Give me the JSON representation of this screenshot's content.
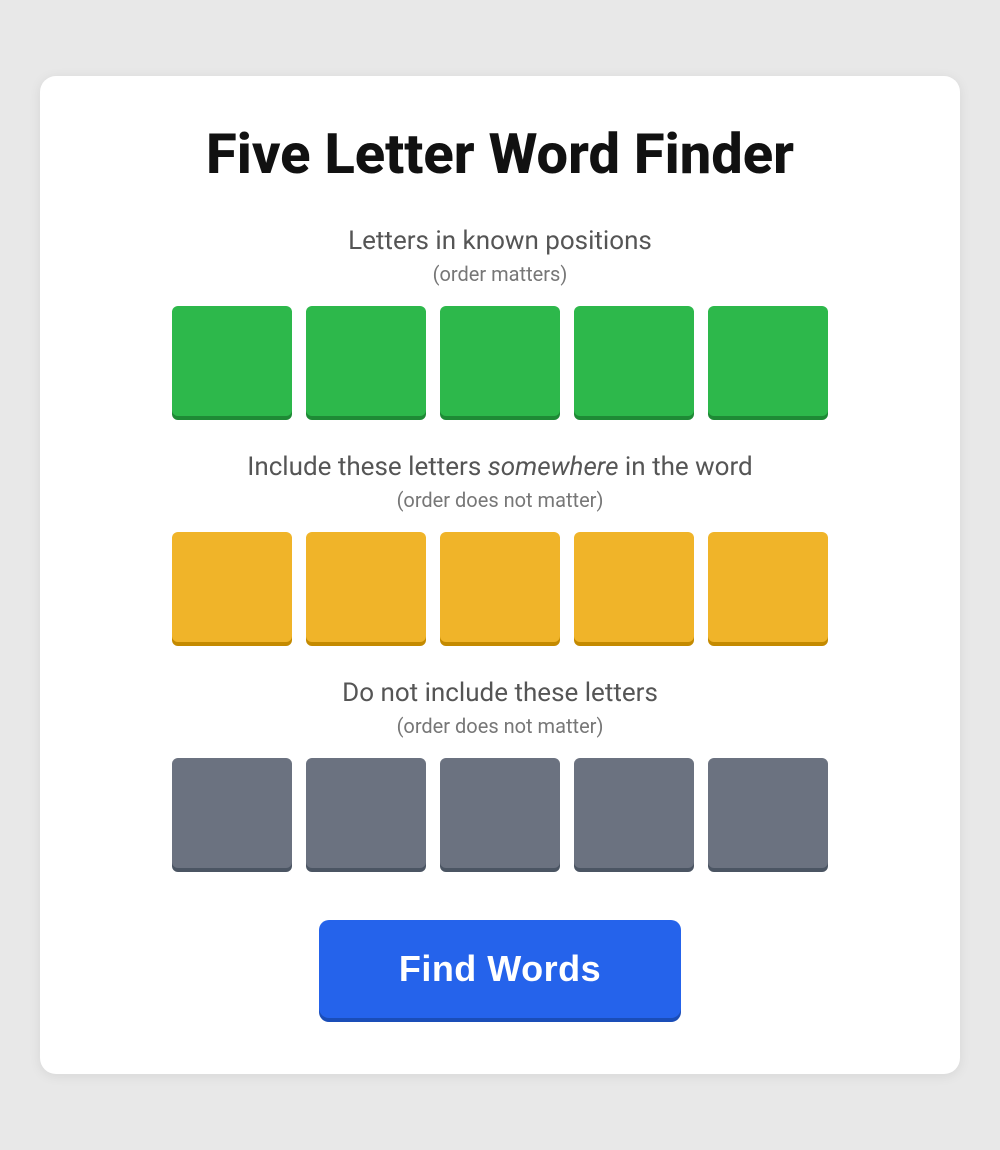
{
  "page": {
    "title": "Five Letter Word Finder",
    "background_color": "#e8e8e8"
  },
  "sections": {
    "known_positions": {
      "title": "Letters in known positions",
      "subtitle": "(order matters)",
      "tile_color": "green",
      "tiles": [
        {
          "id": 1,
          "value": ""
        },
        {
          "id": 2,
          "value": ""
        },
        {
          "id": 3,
          "value": ""
        },
        {
          "id": 4,
          "value": ""
        },
        {
          "id": 5,
          "value": ""
        }
      ]
    },
    "include_letters": {
      "title_start": "Include these letters ",
      "title_italic": "somewhere",
      "title_end": " in the word",
      "subtitle": "(order does not matter)",
      "tile_color": "yellow",
      "tiles": [
        {
          "id": 1,
          "value": ""
        },
        {
          "id": 2,
          "value": ""
        },
        {
          "id": 3,
          "value": ""
        },
        {
          "id": 4,
          "value": ""
        },
        {
          "id": 5,
          "value": ""
        }
      ]
    },
    "exclude_letters": {
      "title": "Do not include these letters",
      "subtitle": "(order does not matter)",
      "tile_color": "gray",
      "tiles": [
        {
          "id": 1,
          "value": ""
        },
        {
          "id": 2,
          "value": ""
        },
        {
          "id": 3,
          "value": ""
        },
        {
          "id": 4,
          "value": ""
        },
        {
          "id": 5,
          "value": ""
        }
      ]
    }
  },
  "button": {
    "label": "Find Words"
  }
}
